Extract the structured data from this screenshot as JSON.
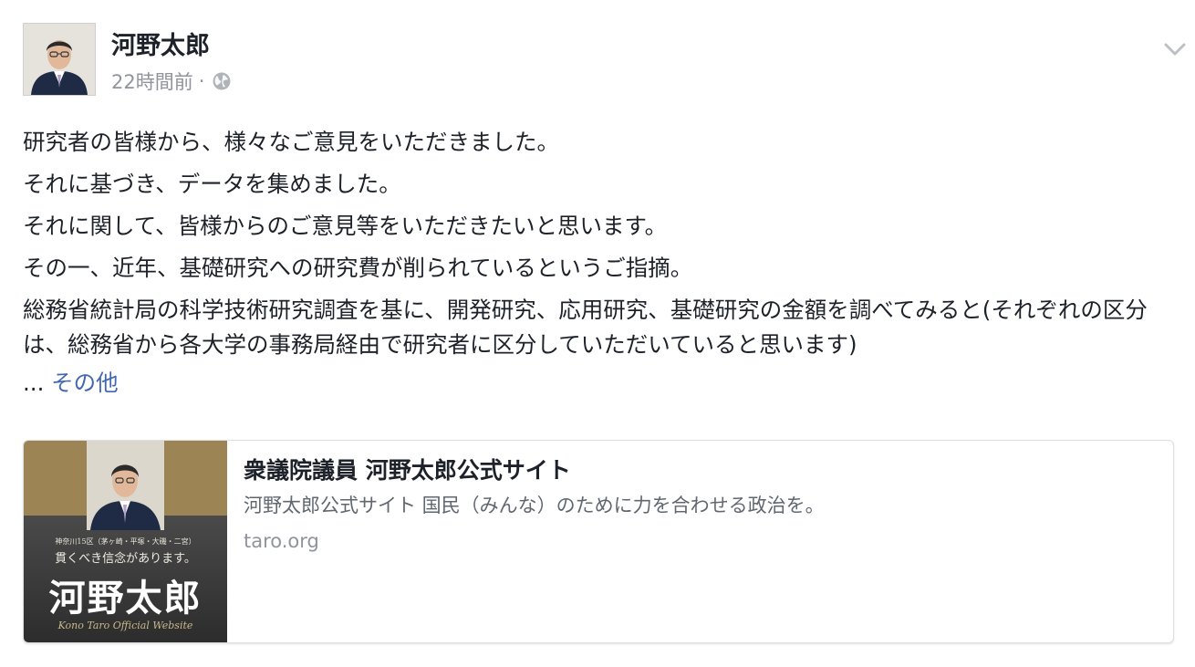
{
  "author": {
    "name": "河野太郎",
    "timestamp": "22時間前",
    "separator": "·",
    "privacy_icon": "globe-icon"
  },
  "post": {
    "paragraphs": [
      "研究者の皆様から、様々なご意見をいただきました。",
      "それに基づき、データを集めました。",
      "それに関して、皆様からのご意見等をいただきたいと思います。",
      "その一、近年、基礎研究への研究費が削られているというご指摘。",
      "総務省統計局の科学技術研究調査を基に、開発研究、応用研究、基礎研究の金額を調べてみると(それぞれの区分は、総務省から各大学の事務局経由で研究者に区分していただいていると思います)"
    ],
    "ellipsis": "...",
    "more_label": "その他"
  },
  "link_card": {
    "title": "衆議院議員 河野太郎公式サイト",
    "description": "河野太郎公式サイト 国民（みんな）のために力を合わせる政治を。",
    "domain": "taro.org",
    "image": {
      "small_line": "神奈川15区（茅ヶ崎・平塚・大磯・二宮）",
      "slogan": "貫くべき信念があります。",
      "name": "河野太郎",
      "caption": "Kono Taro Official Website"
    }
  },
  "menu_icon": "chevron-down-icon",
  "colors": {
    "text": "#1d2129",
    "meta": "#90949c",
    "link": "#4267b2",
    "card_border": "#dddfe2",
    "card_band": "#9c8454"
  }
}
